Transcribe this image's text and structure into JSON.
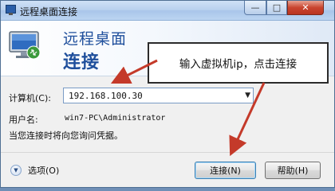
{
  "window": {
    "title": "远程桌面连接",
    "controls": {
      "minimize": "—",
      "maximize": "□",
      "close": "✕"
    }
  },
  "banner": {
    "line1": "远程桌面",
    "line2": "连接"
  },
  "annotation": {
    "callout": "输入虚拟机ip，点击连接"
  },
  "form": {
    "computer_label": "计算机(C):",
    "computer_value": "192.168.100.30",
    "user_label": "用户名:",
    "user_value": "win7-PC\\Administrator",
    "info": "当您连接时将向您询问凭据。"
  },
  "footer": {
    "options_label": "选项(O)",
    "connect_label": "连接(N)",
    "help_label": "帮助(H)"
  },
  "icons": {
    "app": "remote-desktop-icon",
    "banner": "monitor-connection-icon",
    "options": "chevron-down-icon",
    "dropdown": "caret-down-icon"
  },
  "colors": {
    "accent": "#1f4f9c",
    "arrow": "#c43a2a"
  }
}
